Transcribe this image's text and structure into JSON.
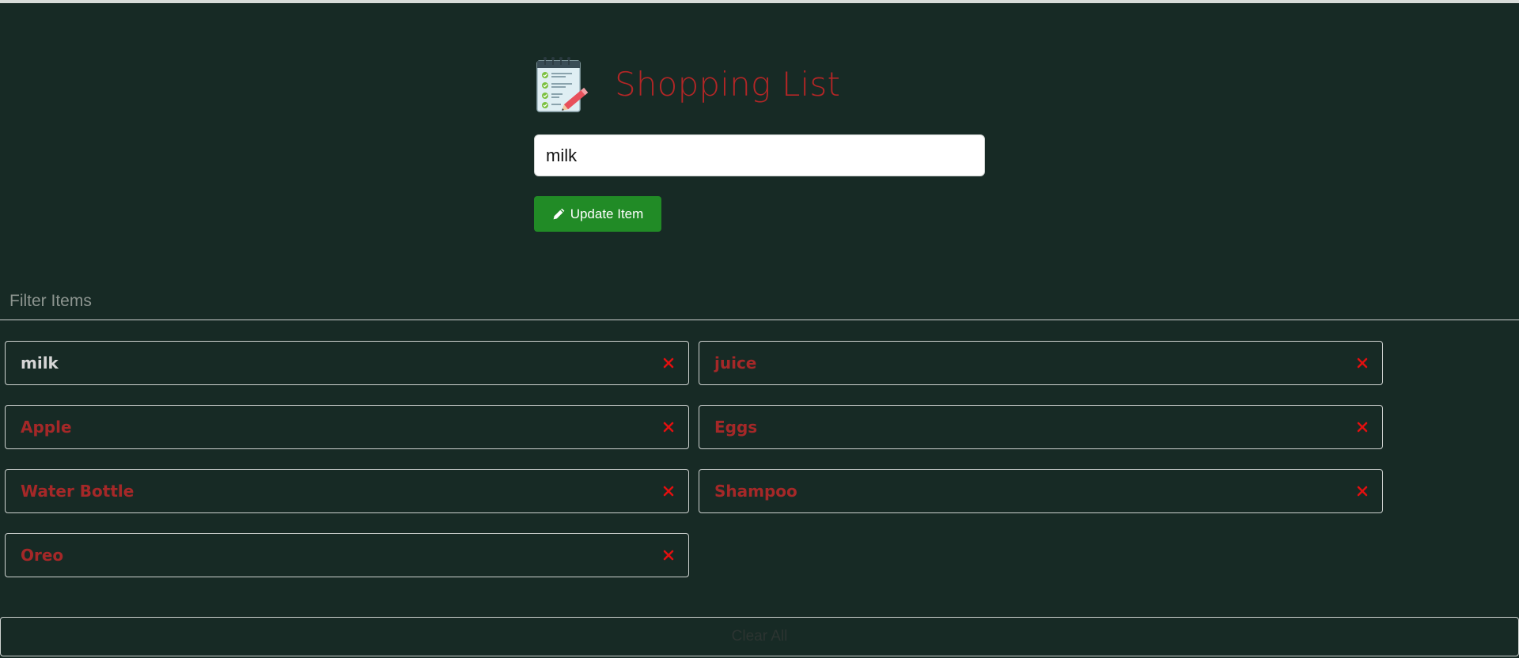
{
  "app": {
    "title": "Shopping List",
    "logo_icon": "notepad-checklist-icon"
  },
  "form": {
    "input_value": "milk",
    "submit_label": "Update Item",
    "submit_icon": "pencil-icon"
  },
  "filter": {
    "placeholder": "Filter Items"
  },
  "items": [
    {
      "label": "milk",
      "editing": true
    },
    {
      "label": "juice"
    },
    {
      "label": "Apple"
    },
    {
      "label": "Eggs"
    },
    {
      "label": "Water Bottle"
    },
    {
      "label": "Shampoo"
    },
    {
      "label": "Oreo"
    }
  ],
  "clear_all_label": "Clear All",
  "colors": {
    "background": "#172a25",
    "accent_red": "#b32626",
    "button_green": "#218b26",
    "remove_icon": "#e01010"
  }
}
